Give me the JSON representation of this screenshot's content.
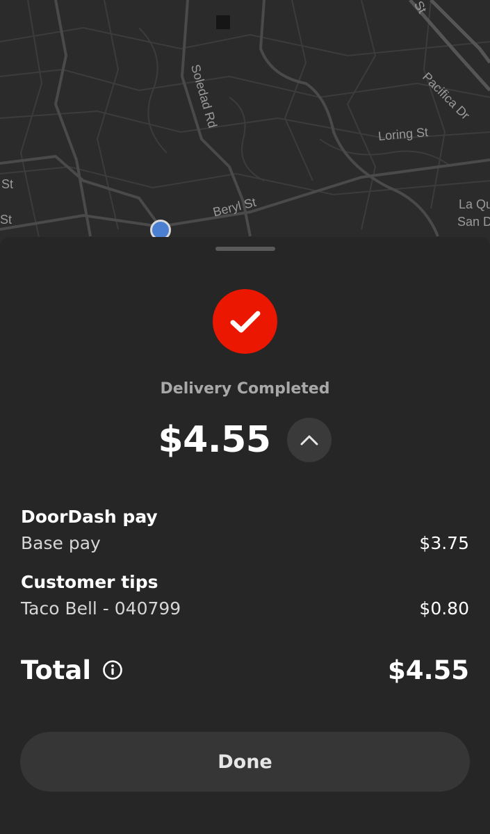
{
  "map": {
    "streets": [
      "Soledad Rd",
      "Beryl St",
      "Loring St",
      "Pacifica Dr",
      "St",
      "St",
      "La Qu",
      "San D",
      "St"
    ]
  },
  "delivery": {
    "status": "Delivery Completed",
    "amount": "$4.55"
  },
  "breakdown": {
    "doordash_title": "DoorDash pay",
    "base_pay_label": "Base pay",
    "base_pay_value": "$3.75",
    "tips_title": "Customer tips",
    "tip_label": "Taco Bell - 040799",
    "tip_value": "$0.80",
    "total_label": "Total",
    "total_value": "$4.55"
  },
  "actions": {
    "done_label": "Done"
  },
  "colors": {
    "accent": "#eb1700",
    "background": "#262626",
    "location_dot": "#4a7fd1"
  },
  "icons": [
    "check-icon",
    "chevron-up-icon",
    "info-icon"
  ]
}
